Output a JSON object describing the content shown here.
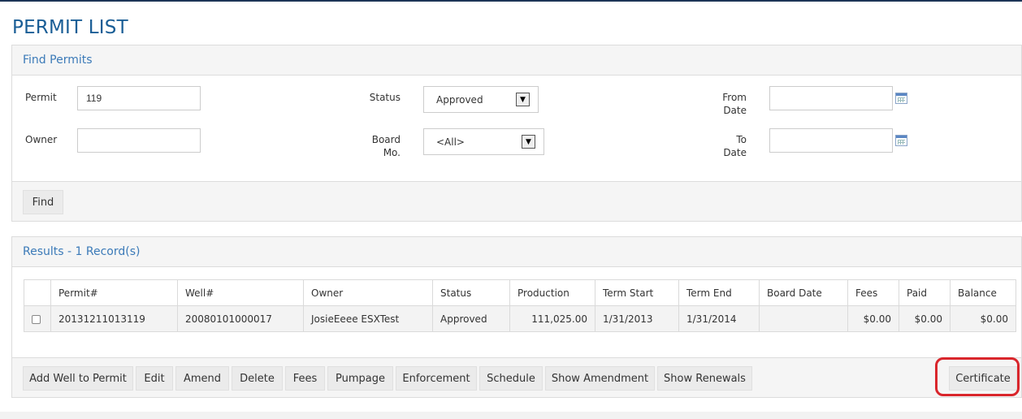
{
  "page": {
    "title": "PERMIT LIST"
  },
  "find": {
    "heading": "Find Permits",
    "permit_label": "Permit",
    "permit_value": "119",
    "owner_label": "Owner",
    "owner_value": "",
    "status_label": "Status",
    "status_value": "Approved",
    "board_label_1": "Board",
    "board_label_2": "Mo.",
    "board_value": "<All>",
    "from_label_1": "From",
    "from_label_2": "Date",
    "from_value": "",
    "to_label_1": "To",
    "to_label_2": "Date",
    "to_value": "",
    "find_button": "Find"
  },
  "results": {
    "heading": "Results - 1 Record(s)",
    "columns": [
      "Permit#",
      "Well#",
      "Owner",
      "Status",
      "Production",
      "Term Start",
      "Term End",
      "Board Date",
      "Fees",
      "Paid",
      "Balance"
    ],
    "rows": [
      {
        "permit": "20131211013119",
        "well": "20080101000017",
        "owner": "JosieEeee ESXTest",
        "status": "Approved",
        "production": "111,025.00",
        "term_start": "1/31/2013",
        "term_end": "1/31/2014",
        "board_date": "",
        "fees": "$0.00",
        "paid": "$0.00",
        "balance": "$0.00"
      }
    ]
  },
  "actions": {
    "add_well": "Add Well to Permit",
    "edit": "Edit",
    "amend": "Amend",
    "delete": "Delete",
    "fees": "Fees",
    "pumpage": "Pumpage",
    "enforcement": "Enforcement",
    "schedule": "Schedule",
    "show_amendment": "Show Amendment",
    "show_renewals": "Show Renewals",
    "certificate": "Certificate"
  },
  "icons": {
    "calendar": "calendar-icon",
    "dropdown": "chevron-down-icon"
  },
  "colors": {
    "title": "#1a5e96",
    "heading": "#3b7ab8",
    "highlight": "#d9262c"
  }
}
